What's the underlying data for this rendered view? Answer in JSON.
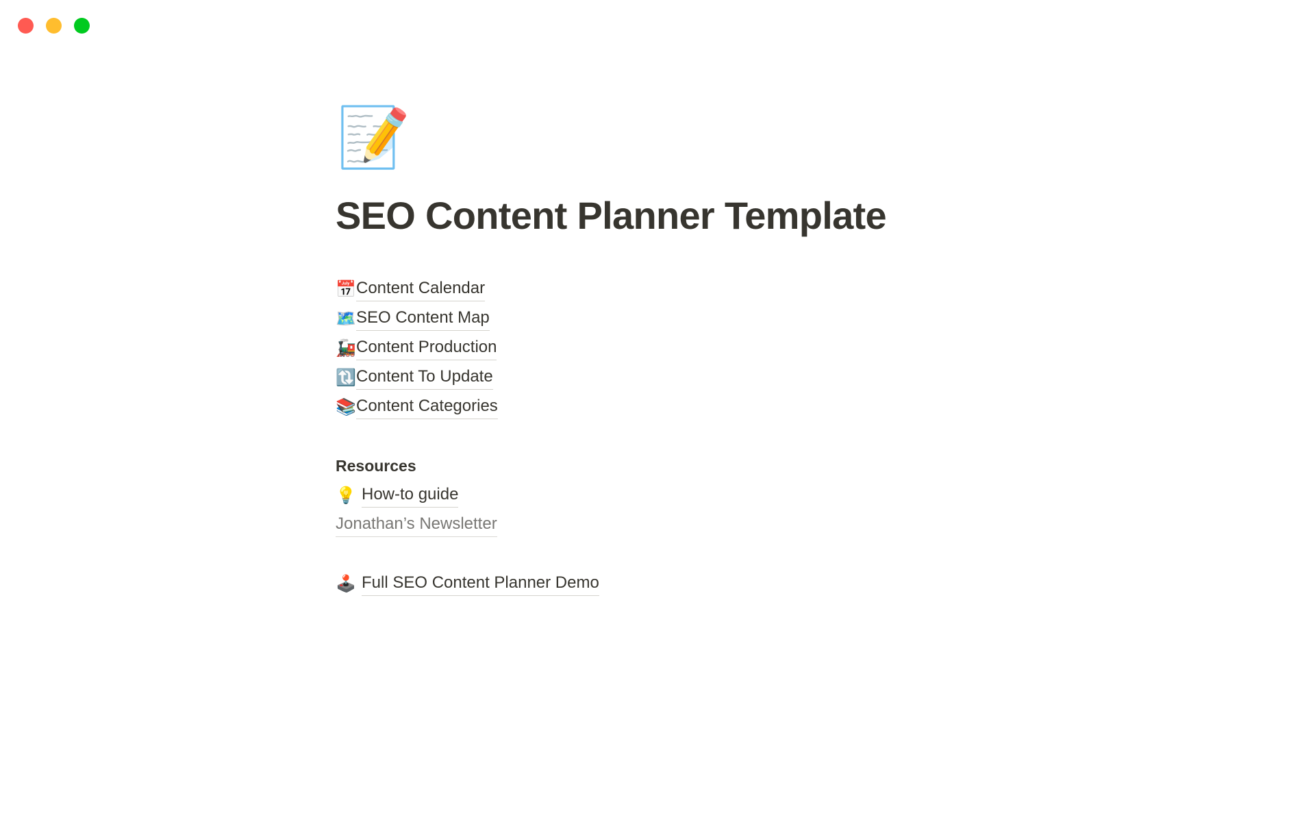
{
  "window": {
    "controls": [
      {
        "name": "close",
        "color": "#ff5a52"
      },
      {
        "name": "minimize",
        "color": "#ffbd2e"
      },
      {
        "name": "maximize",
        "color": "#00ca1f"
      }
    ]
  },
  "page": {
    "icon": "📝",
    "icon_name": "memo-emoji",
    "title": "SEO Content Planner Template",
    "title_color": "#37352f"
  },
  "database_links": [
    {
      "emoji": "📅",
      "icon_name": "calendar-emoji",
      "label": "Content Calendar"
    },
    {
      "emoji": "🗺️",
      "icon_name": "world-map-emoji",
      "label": "SEO Content Map"
    },
    {
      "emoji": "🚂",
      "icon_name": "locomotive-emoji",
      "label": "Content Production"
    },
    {
      "emoji": "🔃",
      "icon_name": "clockwise-vertical-arrows-emoji",
      "label": "Content To Update"
    },
    {
      "emoji": "📚",
      "icon_name": "books-emoji",
      "label": "Content Categories"
    }
  ],
  "resources": {
    "heading": "Resources",
    "items": [
      {
        "emoji": "💡",
        "icon_name": "light-bulb-emoji",
        "label": "How-to guide",
        "muted": false
      },
      {
        "emoji": "",
        "icon_name": "",
        "label": "Jonathan’s Newsletter",
        "muted": true
      }
    ]
  },
  "demo_link": {
    "emoji": "🕹️",
    "icon_name": "joystick-emoji",
    "label": "Full SEO Content Planner Demo"
  }
}
